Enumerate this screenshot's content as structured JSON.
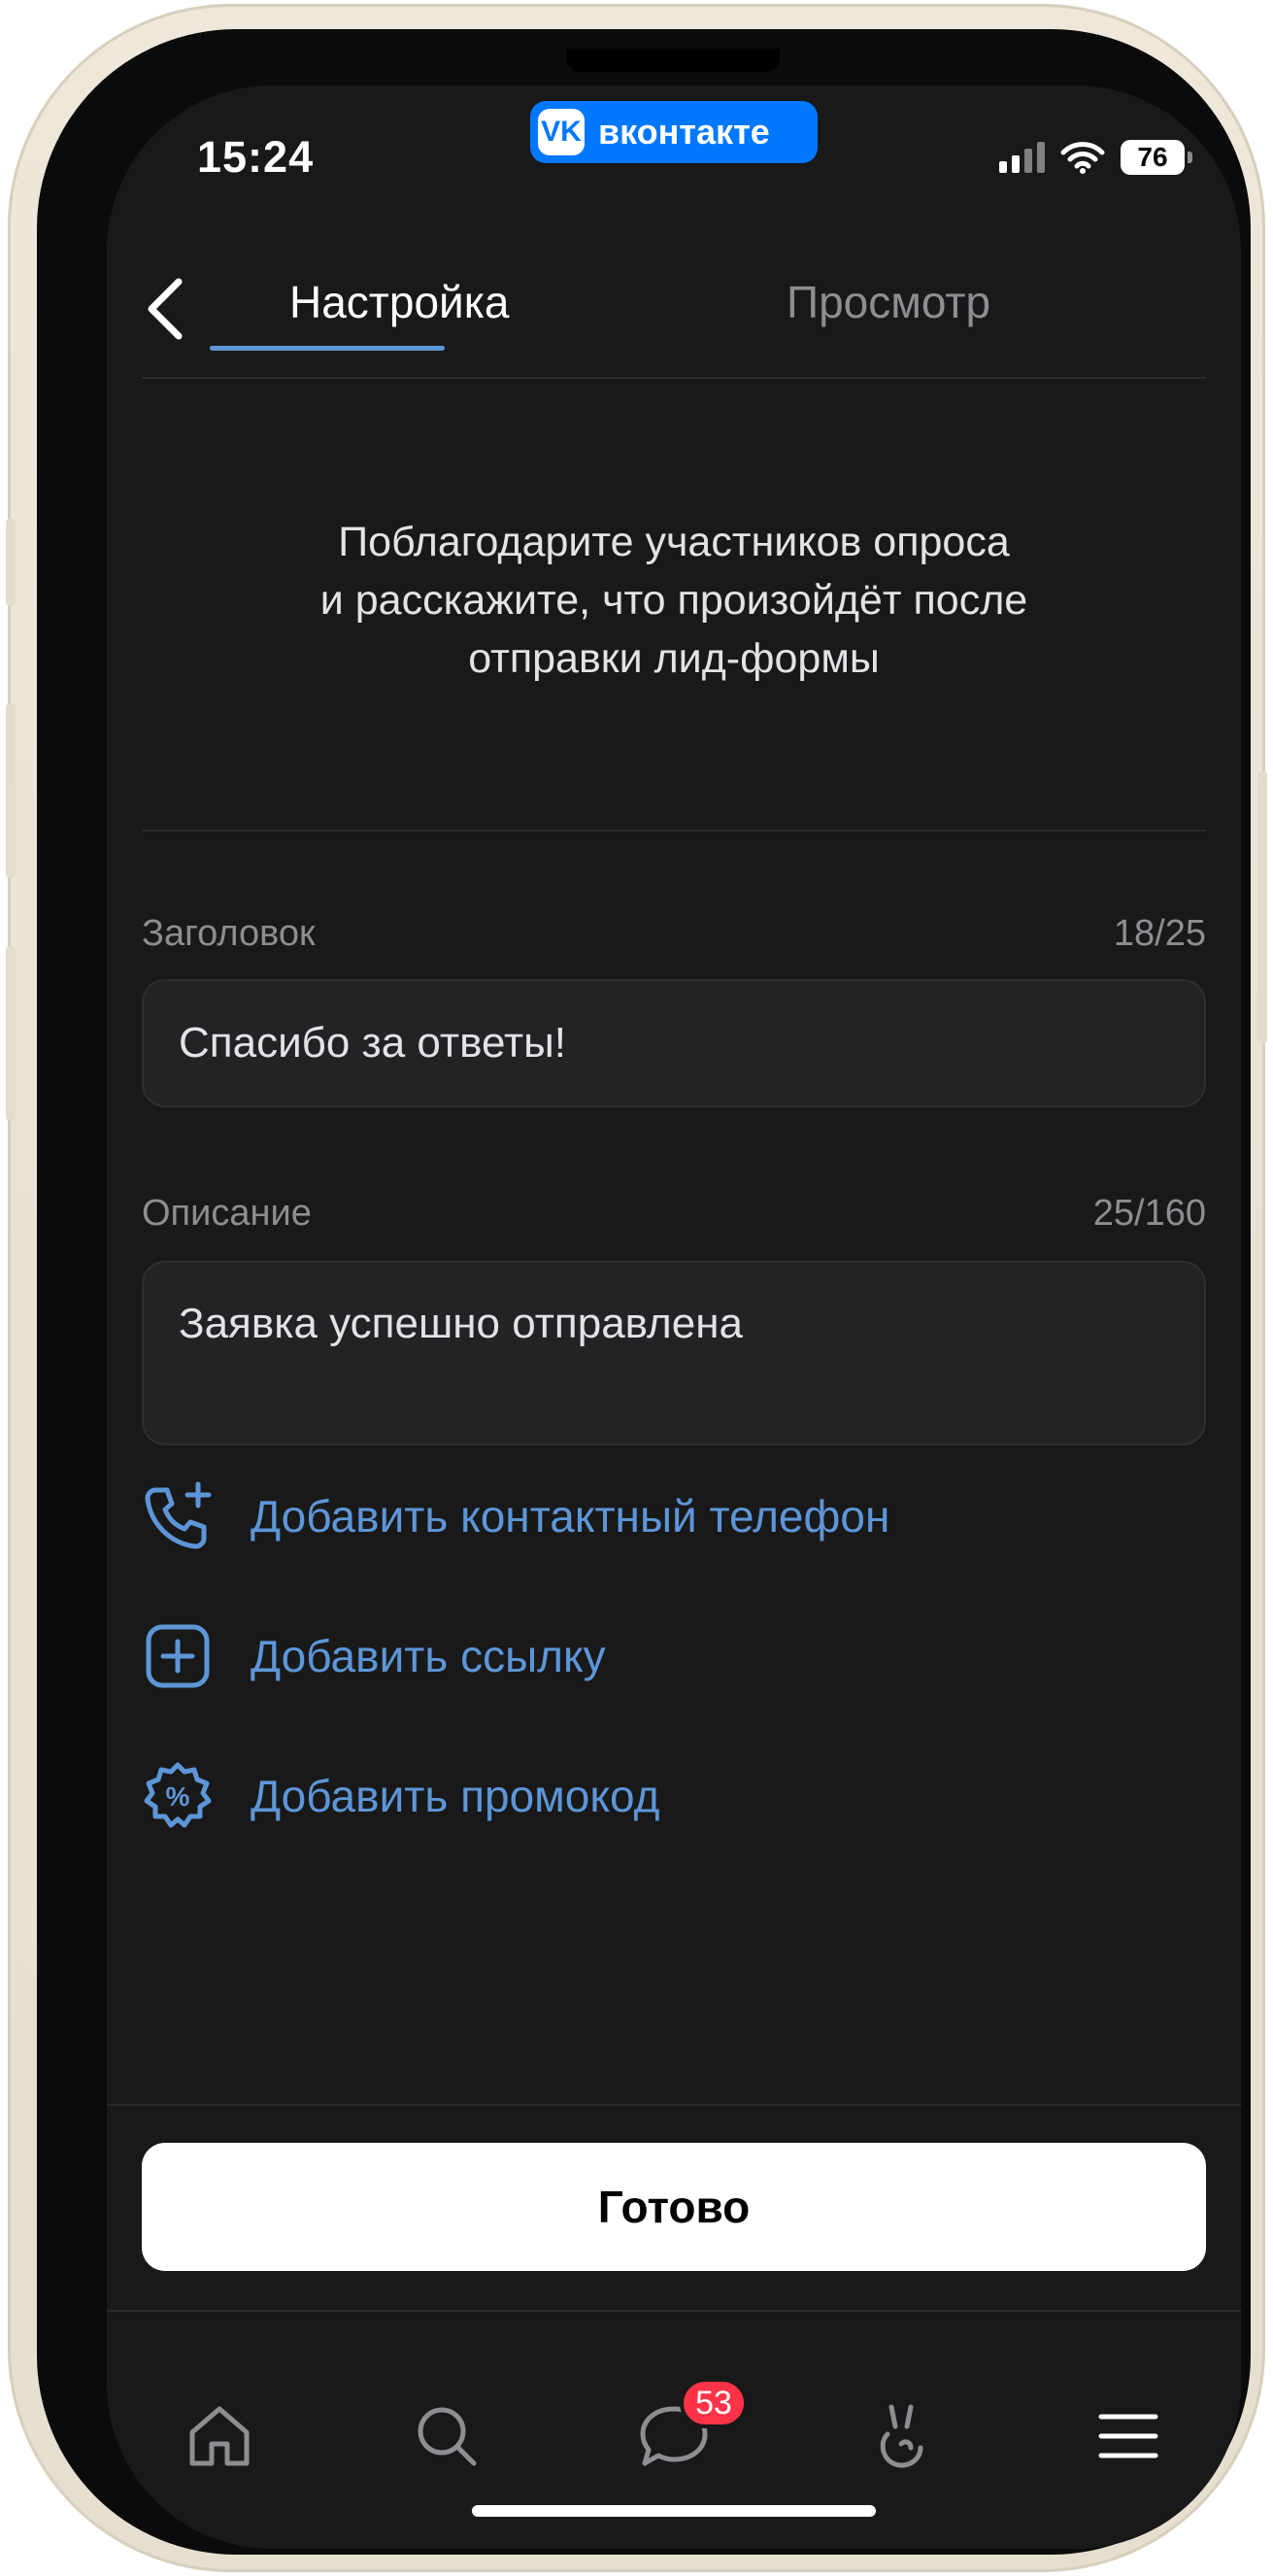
{
  "status_bar": {
    "time": "15:24",
    "app_badge": "вконтакте",
    "app_badge_logo": "VK",
    "battery": "76"
  },
  "tabs": [
    {
      "label": "Настройка",
      "active": true
    },
    {
      "label": "Просмотр",
      "active": false
    }
  ],
  "intro_text": "Поблагодарите участников опроса и расскажите, что произойдёт после отправки лид-формы",
  "intro_lines": [
    "Поблагодарите участников опроса",
    "и расскажите, что произойдёт после",
    "отправки лид-формы"
  ],
  "title_field": {
    "label": "Заголовок",
    "counter": "18/25",
    "value": "Спасибо за ответы!"
  },
  "description_field": {
    "label": "Описание",
    "counter": "25/160",
    "value": "Заявка успешно отправлена"
  },
  "actions": [
    {
      "label": "Добавить контактный телефон",
      "icon": "phone-add-icon"
    },
    {
      "label": "Добавить ссылку",
      "icon": "add-square-icon"
    },
    {
      "label": "Добавить промокод",
      "icon": "discount-icon"
    }
  ],
  "done_button": "Готово",
  "tabbar": {
    "items": [
      {
        "icon": "home-icon"
      },
      {
        "icon": "search-icon"
      },
      {
        "icon": "messages-icon",
        "badge": "53"
      },
      {
        "icon": "services-icon"
      },
      {
        "icon": "menu-icon"
      }
    ]
  },
  "colors": {
    "background": "#19191a",
    "accent": "#5d96d7",
    "vk_blue": "#0077ff",
    "badge_red": "#ff3347"
  }
}
